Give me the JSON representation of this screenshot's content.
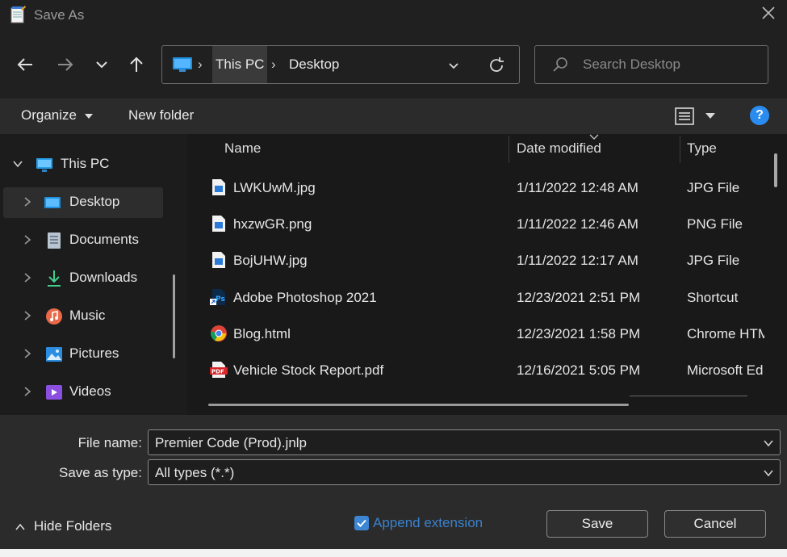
{
  "window": {
    "title": "Save As"
  },
  "nav": {
    "breadcrumb": [
      "This PC",
      "Desktop"
    ],
    "search_placeholder": "Search Desktop"
  },
  "toolbar": {
    "organize": "Organize",
    "new_folder": "New folder"
  },
  "sidebar": {
    "items": [
      {
        "label": "This PC",
        "icon": "monitor-icon"
      },
      {
        "label": "Desktop",
        "icon": "desktop-icon"
      },
      {
        "label": "Documents",
        "icon": "documents-icon"
      },
      {
        "label": "Downloads",
        "icon": "download-icon"
      },
      {
        "label": "Music",
        "icon": "music-icon"
      },
      {
        "label": "Pictures",
        "icon": "pictures-icon"
      },
      {
        "label": "Videos",
        "icon": "videos-icon"
      }
    ]
  },
  "columns": [
    "Name",
    "Date modified",
    "Type"
  ],
  "files": [
    {
      "name": "LWKUwM.jpg",
      "date": "1/11/2022 12:48 AM",
      "type": "JPG File",
      "icon": "image-file-icon"
    },
    {
      "name": "hxzwGR.png",
      "date": "1/11/2022 12:46 AM",
      "type": "PNG File",
      "icon": "image-file-icon"
    },
    {
      "name": "BojUHW.jpg",
      "date": "1/11/2022 12:17 AM",
      "type": "JPG File",
      "icon": "image-file-icon"
    },
    {
      "name": "Adobe Photoshop 2021",
      "date": "12/23/2021 2:51 PM",
      "type": "Shortcut",
      "icon": "photoshop-shortcut-icon"
    },
    {
      "name": "Blog.html",
      "date": "12/23/2021 1:58 PM",
      "type": "Chrome HTM",
      "icon": "chrome-icon"
    },
    {
      "name": "Vehicle Stock Report.pdf",
      "date": "12/16/2021 5:05 PM",
      "type": "Microsoft Ed",
      "icon": "pdf-icon"
    }
  ],
  "form": {
    "file_name_label": "File name:",
    "file_name_value": "Premier Code (Prod).jnlp",
    "save_type_label": "Save as type:",
    "save_type_value": "All types (*.*)"
  },
  "footer": {
    "hide_folders": "Hide Folders",
    "append_extension": "Append extension",
    "append_checked": true,
    "save": "Save",
    "cancel": "Cancel"
  }
}
